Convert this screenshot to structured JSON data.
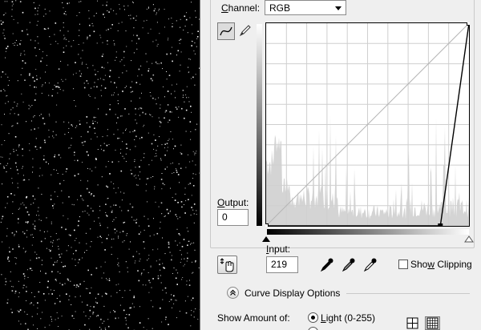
{
  "channel": {
    "label_prefix": "",
    "label_underlined": "C",
    "label_rest": "hannel:",
    "selected": "RGB"
  },
  "output": {
    "label_underlined": "O",
    "label_rest": "utput:",
    "value": "0"
  },
  "input": {
    "label_underlined": "I",
    "label_rest": "nput:",
    "value": "219"
  },
  "show_clipping": {
    "label_before": "Sho",
    "label_underlined": "w",
    "label_after": " Clipping",
    "checked": false
  },
  "curve_display_options": {
    "label": "Curve Display Options"
  },
  "show_amount": {
    "label": "Show Amount of:",
    "light_underlined": "L",
    "light_rest": "ight  (0-255)",
    "light_selected": true
  },
  "curve": {
    "points": [
      [
        0,
        0
      ],
      [
        219,
        0
      ],
      [
        255,
        255
      ]
    ]
  },
  "colors": {
    "accent": "#000000",
    "histogram": "#d4d4d4",
    "grid": "#cfcfcf"
  }
}
